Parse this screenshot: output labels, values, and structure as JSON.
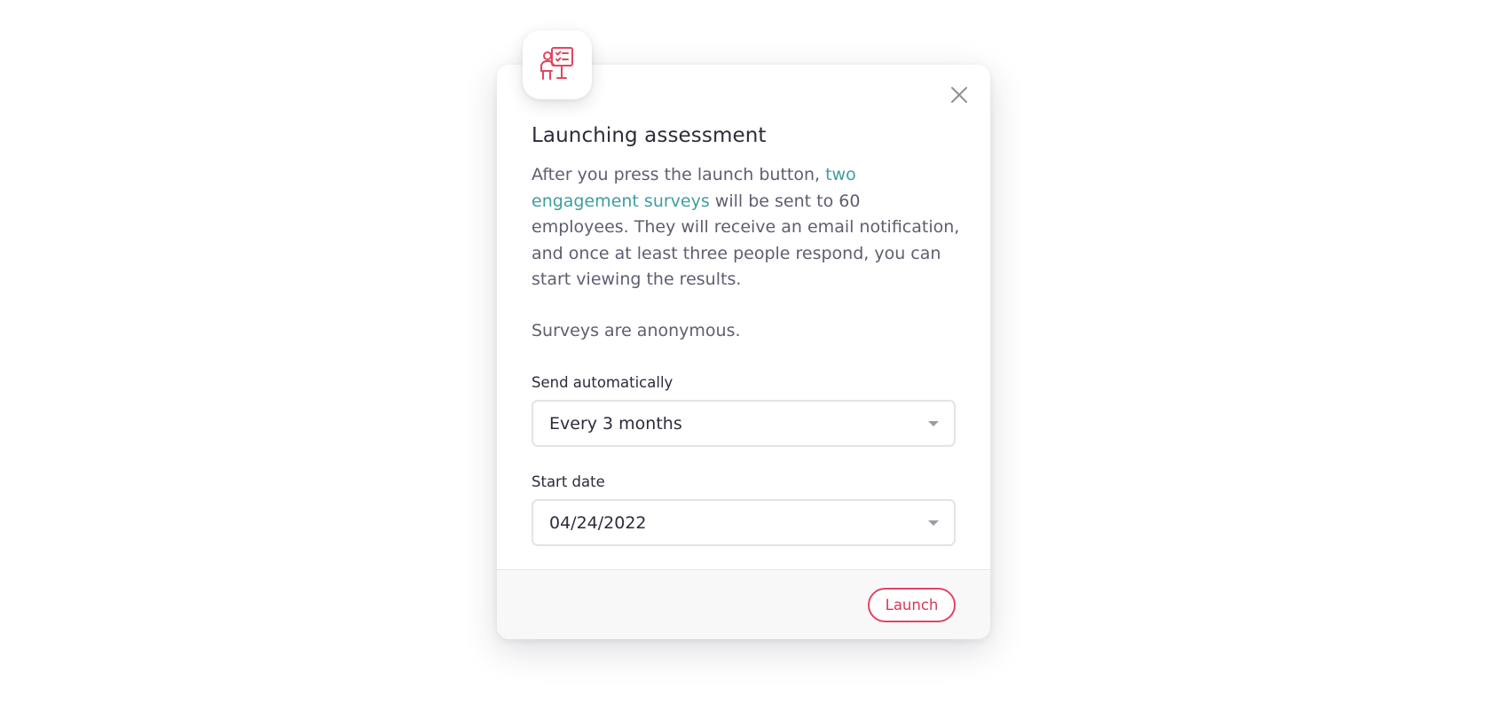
{
  "modal": {
    "icon": "presentation-checklist-icon",
    "close_icon": "close-icon",
    "title": "Launching assessment",
    "description": {
      "before_link": "After you press the launch button, ",
      "link_text": "two engagement surveys",
      "after_link": " will be sent to 60 employees. They will receive an email notification, and once at least three people respond, you can start viewing the results."
    },
    "note": "Surveys are anonymous.",
    "send_automatically": {
      "label": "Send automatically",
      "value": "Every 3 months"
    },
    "start_date": {
      "label": "Start date",
      "value": "04/24/2022"
    },
    "launch_label": "Launch"
  },
  "colors": {
    "accent": "#e0465f",
    "link": "#3d9e9c",
    "text_primary": "#2c2c3a",
    "text_secondary": "#5d5f70"
  }
}
